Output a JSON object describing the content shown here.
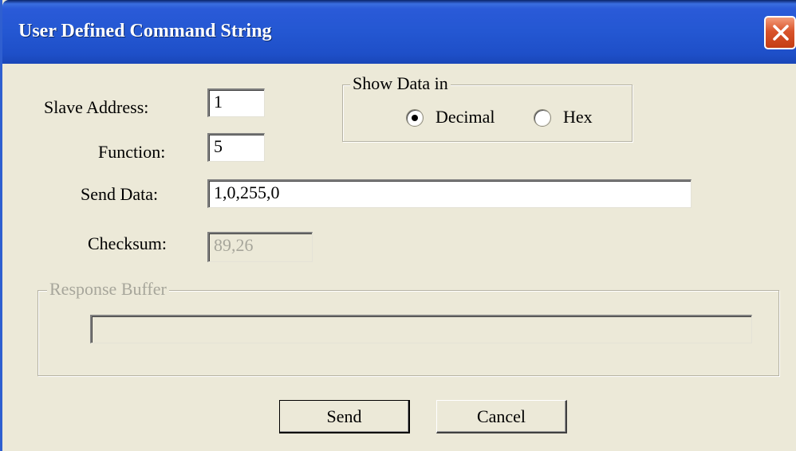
{
  "window": {
    "title": "User Defined Command String"
  },
  "form": {
    "slave_address_label": "Slave Address:",
    "slave_address_value": "1",
    "function_label": "Function:",
    "function_value": "5",
    "send_data_label": "Send Data:",
    "send_data_value": "1,0,255,0",
    "checksum_label": "Checksum:",
    "checksum_value": "89,26"
  },
  "show_data": {
    "legend": "Show Data in",
    "options": [
      {
        "label": "Decimal",
        "selected": true
      },
      {
        "label": "Hex",
        "selected": false
      }
    ]
  },
  "response": {
    "legend": "Response Buffer",
    "value": ""
  },
  "buttons": {
    "send_label": "Send",
    "cancel_label": "Cancel"
  },
  "icons": {
    "close": "close-icon"
  },
  "colors": {
    "titlebar": "#2457d2",
    "close_button": "#d9542b",
    "dialog_bg": "#ece9d8"
  }
}
